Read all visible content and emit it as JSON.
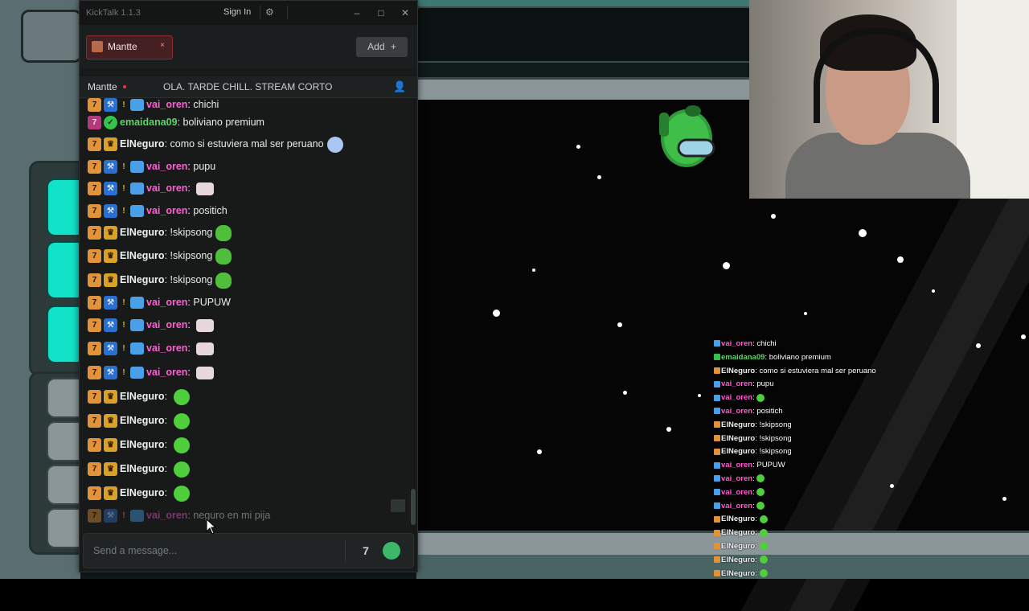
{
  "window": {
    "app_name": "KickTalk 1.1.3",
    "sign_in_label": "Sign In",
    "minimize_symbol": "–",
    "maximize_symbol": "□",
    "close_symbol": "✕"
  },
  "tabs": [
    {
      "label": "Mantte",
      "close_symbol": "×"
    }
  ],
  "add_button": {
    "label": "Add",
    "symbol": "+"
  },
  "channel": {
    "name": "Mantte",
    "stream_title": "OLA. TARDE CHILL. STREAM CORTO"
  },
  "messages": [
    {
      "user": "vai_oren",
      "text": "chichi",
      "user_color": "pink"
    },
    {
      "user": "emaidana09",
      "text": "boliviano premium",
      "user_color": "green"
    },
    {
      "user": "ElNeguro",
      "text": "como si estuviera mal ser peruano",
      "user_color": "white"
    },
    {
      "user": "vai_oren",
      "text": "pupu",
      "user_color": "pink"
    },
    {
      "user": "vai_oren",
      "text": "",
      "user_color": "pink"
    },
    {
      "user": "vai_oren",
      "text": "positich",
      "user_color": "pink"
    },
    {
      "user": "ElNeguro",
      "text": "!skipsong",
      "user_color": "white"
    },
    {
      "user": "ElNeguro",
      "text": "!skipsong",
      "user_color": "white"
    },
    {
      "user": "ElNeguro",
      "text": "!skipsong",
      "user_color": "white"
    },
    {
      "user": "vai_oren",
      "text": "PUPUW",
      "user_color": "pink"
    },
    {
      "user": "vai_oren",
      "text": "",
      "user_color": "pink"
    },
    {
      "user": "vai_oren",
      "text": "",
      "user_color": "pink"
    },
    {
      "user": "vai_oren",
      "text": "",
      "user_color": "pink"
    },
    {
      "user": "ElNeguro",
      "text": "",
      "user_color": "white"
    },
    {
      "user": "ElNeguro",
      "text": "",
      "user_color": "white"
    },
    {
      "user": "ElNeguro",
      "text": "",
      "user_color": "white"
    },
    {
      "user": "ElNeguro",
      "text": "",
      "user_color": "white"
    },
    {
      "user": "ElNeguro",
      "text": "",
      "user_color": "white"
    },
    {
      "user": "vai_oren",
      "text": "neguro en mi pija",
      "user_color": "pink"
    }
  ],
  "input": {
    "placeholder": "Send a message..."
  },
  "overlay_chat": [
    {
      "user": "vai_oren",
      "text": "chichi"
    },
    {
      "user": "emaidana09",
      "text": "boliviano premium"
    },
    {
      "user": "ElNeguro",
      "text": "como si estuviera mal ser peruano"
    },
    {
      "user": "vai_oren",
      "text": "pupu"
    },
    {
      "user": "vai_oren",
      "text": ""
    },
    {
      "user": "vai_oren",
      "text": "positich"
    },
    {
      "user": "ElNeguro",
      "text": "!skipsong"
    },
    {
      "user": "ElNeguro",
      "text": "!skipsong"
    },
    {
      "user": "ElNeguro",
      "text": "!skipsong"
    },
    {
      "user": "vai_oren",
      "text": "PUPUW"
    },
    {
      "user": "vai_oren",
      "text": ""
    },
    {
      "user": "vai_oren",
      "text": ""
    },
    {
      "user": "vai_oren",
      "text": ""
    },
    {
      "user": "ElNeguro",
      "text": ""
    },
    {
      "user": "ElNeguro",
      "text": ""
    },
    {
      "user": "ElNeguro",
      "text": ""
    },
    {
      "user": "ElNeguro",
      "text": ""
    },
    {
      "user": "ElNeguro",
      "text": ""
    }
  ],
  "colors": {
    "username_pink": "#ff5fd2",
    "username_green": "#5dd46a",
    "tab_active_border": "#8a2c2c",
    "live_dot": "#e23b3b"
  }
}
